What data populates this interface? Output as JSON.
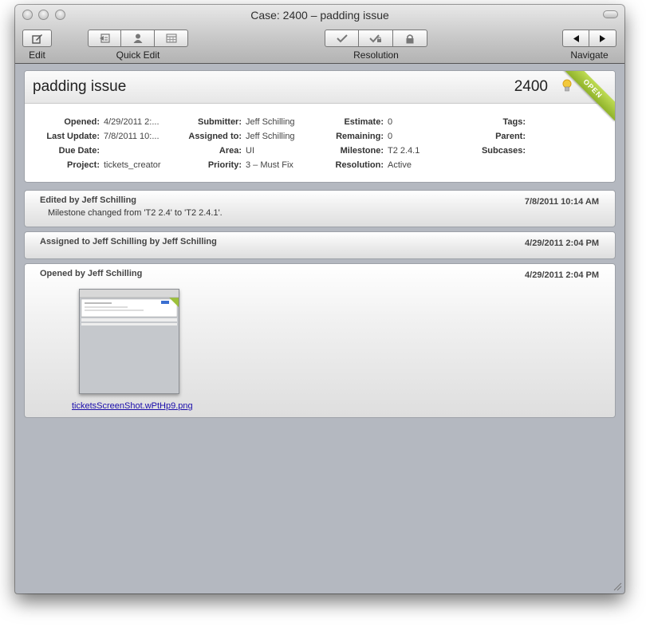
{
  "window": {
    "title": "Case: 2400 – padding issue"
  },
  "toolbar": {
    "edit_label": "Edit",
    "quick_edit_label": "Quick Edit",
    "resolution_label": "Resolution",
    "navigate_label": "Navigate",
    "icons": [
      "edit-icon",
      "move-icon",
      "assign-icon",
      "calendar-icon",
      "resolve-icon",
      "resolve-close-icon",
      "close-icon",
      "previous-icon",
      "next-icon"
    ]
  },
  "case": {
    "title": "padding issue",
    "number": "2400",
    "status": "OPEN",
    "status_color": "#9dc13a",
    "fields": {
      "opened": {
        "label": "Opened:",
        "value": "4/29/2011 2:..."
      },
      "last_update": {
        "label": "Last Update:",
        "value": "7/8/2011 10:..."
      },
      "due_date": {
        "label": "Due Date:",
        "value": ""
      },
      "project": {
        "label": "Project:",
        "value": "tickets_creator"
      },
      "submitter": {
        "label": "Submitter:",
        "value": "Jeff Schilling"
      },
      "assigned_to": {
        "label": "Assigned to:",
        "value": "Jeff Schilling"
      },
      "area": {
        "label": "Area:",
        "value": "UI"
      },
      "priority": {
        "label": "Priority:",
        "value": "3 – Must Fix"
      },
      "estimate": {
        "label": "Estimate:",
        "value": "0"
      },
      "remaining": {
        "label": "Remaining:",
        "value": "0"
      },
      "milestone": {
        "label": "Milestone:",
        "value": "T2 2.4.1"
      },
      "resolution": {
        "label": "Resolution:",
        "value": "Active"
      },
      "tags": {
        "label": "Tags:",
        "value": ""
      },
      "parent": {
        "label": "Parent:",
        "value": ""
      },
      "subcases": {
        "label": "Subcases:",
        "value": ""
      }
    }
  },
  "events": [
    {
      "title": "Edited by Jeff Schilling",
      "date": "7/8/2011 10:14 AM",
      "description": "Milestone changed from 'T2 2.4' to 'T2 2.4.1'."
    },
    {
      "title": "Assigned to Jeff Schilling by Jeff Schilling",
      "date": "4/29/2011 2:04 PM"
    },
    {
      "title": "Opened by Jeff Schilling",
      "date": "4/29/2011 2:04 PM",
      "attachment": "ticketsScreenShot.wPtHp9.png"
    }
  ]
}
